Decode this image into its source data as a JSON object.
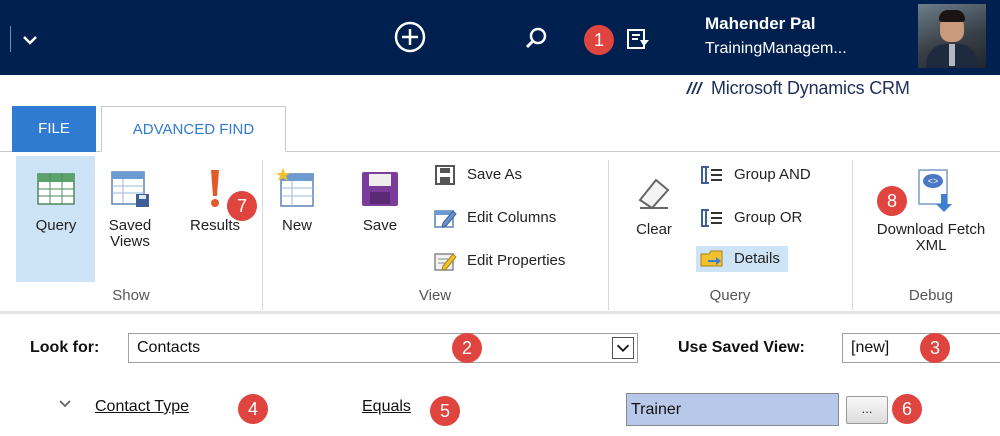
{
  "topbar": {
    "user_name": "Mahender Pal",
    "org_name": "TrainingManagem...",
    "bg_color": "#002050"
  },
  "brand": {
    "name": "Microsoft Dynamics CRM"
  },
  "tabs": [
    {
      "label": "FILE",
      "active": false
    },
    {
      "label": "ADVANCED FIND",
      "active": true
    }
  ],
  "ribbon": {
    "groups": {
      "show": "Show",
      "view": "View",
      "query": "Query",
      "debug": "Debug"
    },
    "query_label": "Query",
    "saved_views_label": [
      "Saved",
      "Views"
    ],
    "results_label": "Results",
    "new_label": "New",
    "save_label": "Save",
    "save_as_label": "Save As",
    "edit_columns_label": "Edit Columns",
    "edit_properties_label": "Edit Properties",
    "clear_label": "Clear",
    "group_and_label": "Group AND",
    "group_or_label": "Group OR",
    "details_label": "Details",
    "download_label": [
      "Download Fetch",
      "XML"
    ]
  },
  "find": {
    "look_for_label": "Look for:",
    "look_for_value": "Contacts",
    "saved_view_label": "Use Saved View:",
    "saved_view_value": "[new]"
  },
  "condition": {
    "field": "Contact Type",
    "operator": "Equals",
    "value": "Trainer",
    "lookup_label": "..."
  },
  "badges": [
    "1",
    "2",
    "3",
    "4",
    "5",
    "6",
    "7",
    "8"
  ],
  "colors": {
    "accent": "#2e7bd1",
    "badge": "#e0443e",
    "active_bg": "#cde4f7"
  }
}
